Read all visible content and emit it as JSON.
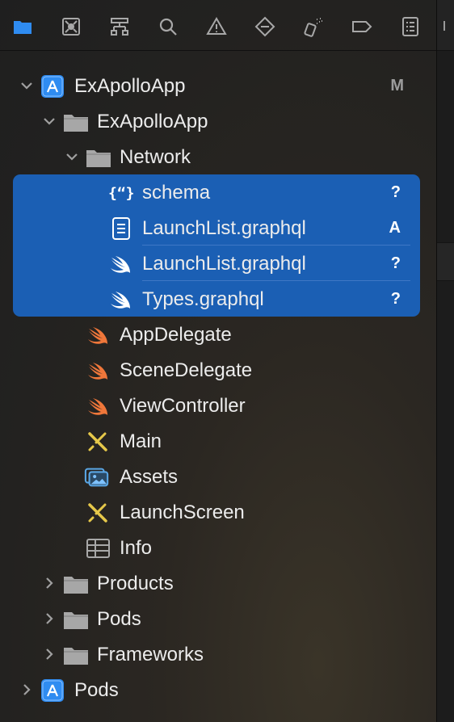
{
  "toolbar": {
    "items": [
      {
        "name": "project-navigator",
        "icon": "folder-icon",
        "active": true
      },
      {
        "name": "source-control",
        "icon": "source-control-icon"
      },
      {
        "name": "symbol",
        "icon": "symbol-hierarchy-icon"
      },
      {
        "name": "find",
        "icon": "search-icon"
      },
      {
        "name": "issues",
        "icon": "warning-icon"
      },
      {
        "name": "tests",
        "icon": "diamond-minus-icon"
      },
      {
        "name": "debug",
        "icon": "spray-icon"
      },
      {
        "name": "breakpoints",
        "icon": "tag-icon"
      },
      {
        "name": "reports",
        "icon": "list-icon"
      }
    ]
  },
  "tree": {
    "project": {
      "label": "ExApolloApp",
      "badge": "M"
    },
    "group": {
      "label": "ExApolloApp"
    },
    "network": {
      "label": "Network"
    },
    "files": [
      {
        "label": "schema",
        "badge": "?"
      },
      {
        "label": "LaunchList.graphql",
        "badge": "A"
      },
      {
        "label": "LaunchList.graphql",
        "badge": "?"
      },
      {
        "label": "Types.graphql",
        "badge": "?"
      }
    ],
    "sources": [
      {
        "label": "AppDelegate"
      },
      {
        "label": "SceneDelegate"
      },
      {
        "label": "ViewController"
      },
      {
        "label": "Main"
      },
      {
        "label": "Assets"
      },
      {
        "label": "LaunchScreen"
      },
      {
        "label": "Info"
      }
    ],
    "groups": [
      {
        "label": "Products"
      },
      {
        "label": "Pods"
      },
      {
        "label": "Frameworks"
      }
    ],
    "pods_project": {
      "label": "Pods"
    }
  },
  "colors": {
    "selection": "#1b5fb4",
    "accent": "#2f8cf1",
    "swift": "#f0773a"
  }
}
